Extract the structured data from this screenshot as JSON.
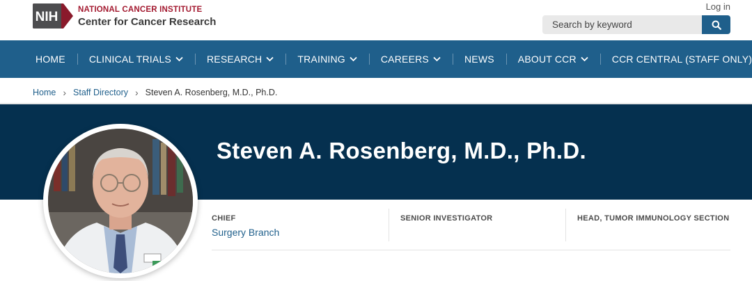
{
  "header": {
    "logo_text": "NIH",
    "institute_line1": "NATIONAL CANCER INSTITUTE",
    "institute_line2": "Center for Cancer Research",
    "login_label": "Log in",
    "search_placeholder": "Search by keyword",
    "colors": {
      "brand_red": "#a3192f",
      "nav_blue": "#1f5f8b",
      "banner_navy": "#05304f"
    }
  },
  "nav": {
    "items": [
      {
        "label": "HOME",
        "dropdown": false
      },
      {
        "label": "CLINICAL TRIALS",
        "dropdown": true
      },
      {
        "label": "RESEARCH",
        "dropdown": true
      },
      {
        "label": "TRAINING",
        "dropdown": true
      },
      {
        "label": "CAREERS",
        "dropdown": true
      },
      {
        "label": "NEWS",
        "dropdown": false
      },
      {
        "label": "ABOUT CCR",
        "dropdown": true
      },
      {
        "label": "CCR CENTRAL (STAFF ONLY)",
        "dropdown": false
      }
    ]
  },
  "breadcrumb": {
    "items": [
      "Home",
      "Staff Directory"
    ],
    "current": "Steven A. Rosenberg, M.D., Ph.D."
  },
  "profile": {
    "name": "Steven A. Rosenberg, M.D., Ph.D.",
    "titles": [
      {
        "label": "CHIEF",
        "link": "Surgery Branch"
      },
      {
        "label": "SENIOR INVESTIGATOR",
        "link": ""
      },
      {
        "label": "HEAD, TUMOR IMMUNOLOGY SECTION",
        "link": ""
      }
    ]
  }
}
